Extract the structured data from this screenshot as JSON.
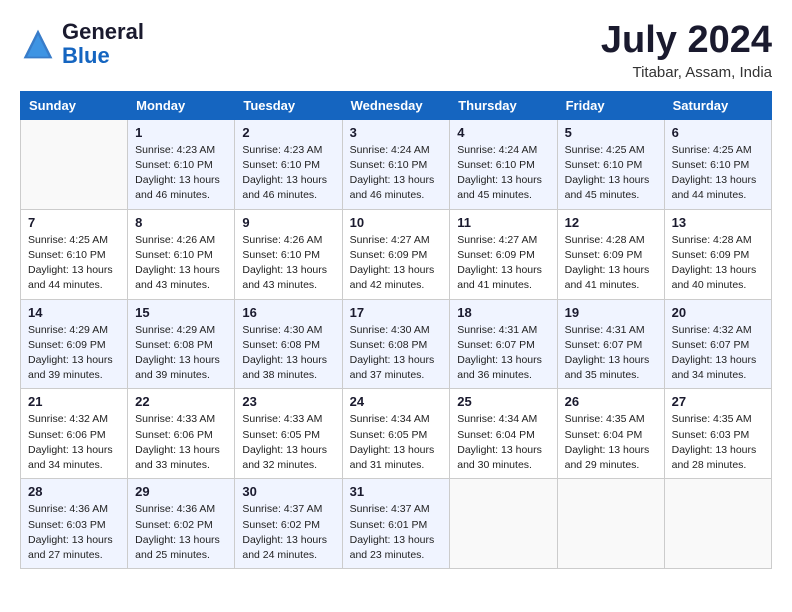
{
  "header": {
    "logo_general": "General",
    "logo_blue": "Blue",
    "month_year": "July 2024",
    "location": "Titabar, Assam, India"
  },
  "columns": [
    "Sunday",
    "Monday",
    "Tuesday",
    "Wednesday",
    "Thursday",
    "Friday",
    "Saturday"
  ],
  "weeks": [
    [
      {
        "day": "",
        "sunrise": "",
        "sunset": "",
        "daylight": ""
      },
      {
        "day": "1",
        "sunrise": "4:23 AM",
        "sunset": "6:10 PM",
        "daylight": "13 hours and 46 minutes."
      },
      {
        "day": "2",
        "sunrise": "4:23 AM",
        "sunset": "6:10 PM",
        "daylight": "13 hours and 46 minutes."
      },
      {
        "day": "3",
        "sunrise": "4:24 AM",
        "sunset": "6:10 PM",
        "daylight": "13 hours and 46 minutes."
      },
      {
        "day": "4",
        "sunrise": "4:24 AM",
        "sunset": "6:10 PM",
        "daylight": "13 hours and 45 minutes."
      },
      {
        "day": "5",
        "sunrise": "4:25 AM",
        "sunset": "6:10 PM",
        "daylight": "13 hours and 45 minutes."
      },
      {
        "day": "6",
        "sunrise": "4:25 AM",
        "sunset": "6:10 PM",
        "daylight": "13 hours and 44 minutes."
      }
    ],
    [
      {
        "day": "7",
        "sunrise": "4:25 AM",
        "sunset": "6:10 PM",
        "daylight": "13 hours and 44 minutes."
      },
      {
        "day": "8",
        "sunrise": "4:26 AM",
        "sunset": "6:10 PM",
        "daylight": "13 hours and 43 minutes."
      },
      {
        "day": "9",
        "sunrise": "4:26 AM",
        "sunset": "6:10 PM",
        "daylight": "13 hours and 43 minutes."
      },
      {
        "day": "10",
        "sunrise": "4:27 AM",
        "sunset": "6:09 PM",
        "daylight": "13 hours and 42 minutes."
      },
      {
        "day": "11",
        "sunrise": "4:27 AM",
        "sunset": "6:09 PM",
        "daylight": "13 hours and 41 minutes."
      },
      {
        "day": "12",
        "sunrise": "4:28 AM",
        "sunset": "6:09 PM",
        "daylight": "13 hours and 41 minutes."
      },
      {
        "day": "13",
        "sunrise": "4:28 AM",
        "sunset": "6:09 PM",
        "daylight": "13 hours and 40 minutes."
      }
    ],
    [
      {
        "day": "14",
        "sunrise": "4:29 AM",
        "sunset": "6:09 PM",
        "daylight": "13 hours and 39 minutes."
      },
      {
        "day": "15",
        "sunrise": "4:29 AM",
        "sunset": "6:08 PM",
        "daylight": "13 hours and 39 minutes."
      },
      {
        "day": "16",
        "sunrise": "4:30 AM",
        "sunset": "6:08 PM",
        "daylight": "13 hours and 38 minutes."
      },
      {
        "day": "17",
        "sunrise": "4:30 AM",
        "sunset": "6:08 PM",
        "daylight": "13 hours and 37 minutes."
      },
      {
        "day": "18",
        "sunrise": "4:31 AM",
        "sunset": "6:07 PM",
        "daylight": "13 hours and 36 minutes."
      },
      {
        "day": "19",
        "sunrise": "4:31 AM",
        "sunset": "6:07 PM",
        "daylight": "13 hours and 35 minutes."
      },
      {
        "day": "20",
        "sunrise": "4:32 AM",
        "sunset": "6:07 PM",
        "daylight": "13 hours and 34 minutes."
      }
    ],
    [
      {
        "day": "21",
        "sunrise": "4:32 AM",
        "sunset": "6:06 PM",
        "daylight": "13 hours and 34 minutes."
      },
      {
        "day": "22",
        "sunrise": "4:33 AM",
        "sunset": "6:06 PM",
        "daylight": "13 hours and 33 minutes."
      },
      {
        "day": "23",
        "sunrise": "4:33 AM",
        "sunset": "6:05 PM",
        "daylight": "13 hours and 32 minutes."
      },
      {
        "day": "24",
        "sunrise": "4:34 AM",
        "sunset": "6:05 PM",
        "daylight": "13 hours and 31 minutes."
      },
      {
        "day": "25",
        "sunrise": "4:34 AM",
        "sunset": "6:04 PM",
        "daylight": "13 hours and 30 minutes."
      },
      {
        "day": "26",
        "sunrise": "4:35 AM",
        "sunset": "6:04 PM",
        "daylight": "13 hours and 29 minutes."
      },
      {
        "day": "27",
        "sunrise": "4:35 AM",
        "sunset": "6:03 PM",
        "daylight": "13 hours and 28 minutes."
      }
    ],
    [
      {
        "day": "28",
        "sunrise": "4:36 AM",
        "sunset": "6:03 PM",
        "daylight": "13 hours and 27 minutes."
      },
      {
        "day": "29",
        "sunrise": "4:36 AM",
        "sunset": "6:02 PM",
        "daylight": "13 hours and 25 minutes."
      },
      {
        "day": "30",
        "sunrise": "4:37 AM",
        "sunset": "6:02 PM",
        "daylight": "13 hours and 24 minutes."
      },
      {
        "day": "31",
        "sunrise": "4:37 AM",
        "sunset": "6:01 PM",
        "daylight": "13 hours and 23 minutes."
      },
      {
        "day": "",
        "sunrise": "",
        "sunset": "",
        "daylight": ""
      },
      {
        "day": "",
        "sunrise": "",
        "sunset": "",
        "daylight": ""
      },
      {
        "day": "",
        "sunrise": "",
        "sunset": "",
        "daylight": ""
      }
    ]
  ]
}
